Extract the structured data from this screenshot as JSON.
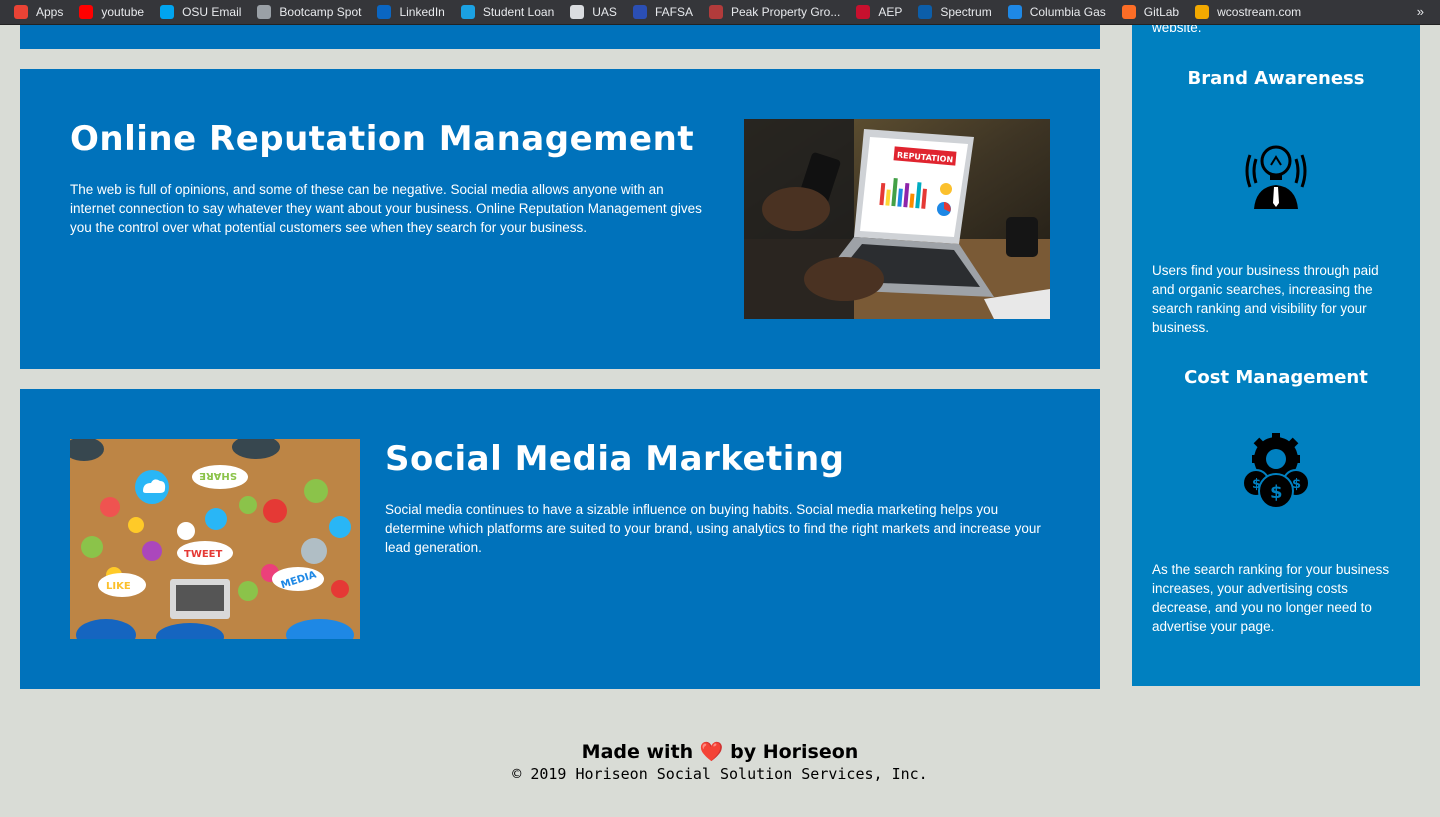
{
  "bookmarks": [
    {
      "label": "Apps",
      "icon": "apps-grid-icon",
      "color": "#ea4335"
    },
    {
      "label": "youtube",
      "icon": "youtube-icon",
      "color": "#ff0000"
    },
    {
      "label": "OSU Email",
      "icon": "microsoft-icon",
      "color": "#00a4ef"
    },
    {
      "label": "Bootcamp Spot",
      "icon": "globe-icon",
      "color": "#9aa0a6"
    },
    {
      "label": "LinkedIn",
      "icon": "linkedin-icon",
      "color": "#0a66c2"
    },
    {
      "label": "Student Loan",
      "icon": "student-loan-icon",
      "color": "#1ba1e2"
    },
    {
      "label": "UAS",
      "icon": "document-icon",
      "color": "#dadce0"
    },
    {
      "label": "FAFSA",
      "icon": "fafsa-icon",
      "color": "#2b4fb4"
    },
    {
      "label": "Peak Property Gro...",
      "icon": "building-icon",
      "color": "#b23b3b"
    },
    {
      "label": "AEP",
      "icon": "aep-icon",
      "color": "#c8102e"
    },
    {
      "label": "Spectrum",
      "icon": "spectrum-icon",
      "color": "#0c5ea9"
    },
    {
      "label": "Columbia Gas",
      "icon": "gas-flame-icon",
      "color": "#1e88e5"
    },
    {
      "label": "GitLab",
      "icon": "gitlab-icon",
      "color": "#fc6d26"
    },
    {
      "label": "wcostream.com",
      "icon": "wco-icon",
      "color": "#f2a900"
    }
  ],
  "bookmarks_more": "»",
  "sections": {
    "reputation": {
      "title": "Online Reputation Management",
      "body": "The web is full of opinions, and some of these can be negative. Social media allows anyone with an internet connection to say whatever they want about your business. Online Reputation Management gives you the control over what potential customers see when they search for your business.",
      "image_label": "REPUTATION"
    },
    "social": {
      "title": "Social Media Marketing",
      "body": "Social media continues to have a sizable influence on buying habits. Social media marketing helps you determine which platforms are suited to your brand, using analytics to find the right markets and increase your lead generation.",
      "image_words": [
        "SHARE",
        "TWEET",
        "LIKE",
        "MEDIA"
      ]
    }
  },
  "sidebar": {
    "cut_text": "website.",
    "brand": {
      "title": "Brand Awareness",
      "body": "Users find your business through paid and organic searches, increasing the search ranking and visibility for your business."
    },
    "cost": {
      "title": "Cost Management",
      "body": "As the search ranking for your business increases, your advertising costs decrease, and you no longer need to advertise your page."
    }
  },
  "footer": {
    "made_prefix": "Made with",
    "heart": "❤️",
    "made_suffix": "by Horiseon",
    "copyright": "© 2019 Horiseon Social Solution Services, Inc."
  },
  "colors": {
    "page_bg": "#d9dcd6",
    "card_bg": "#0072bb",
    "sidebar_bg": "#0080c0"
  }
}
